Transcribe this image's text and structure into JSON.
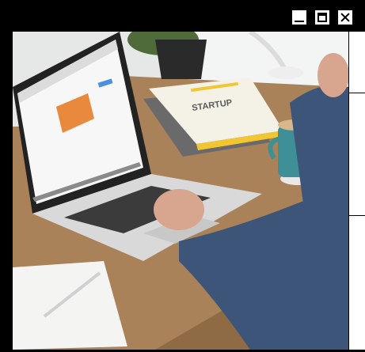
{
  "window": {
    "title": "",
    "controls": [
      "minimize-icon",
      "maximize-icon",
      "close-icon"
    ]
  },
  "photo": {
    "book_title": "STARTUP"
  },
  "colors": {
    "frame": "#000000",
    "desk": "#a9825a",
    "wall": "#e6e8e7",
    "laptop": "#d9d9d9",
    "screen_accent": "#e8893d",
    "book_cover": "#f4f1e6",
    "book_stripe": "#f2c631",
    "mug": "#3f8f97",
    "shirt": "#3c5578"
  }
}
